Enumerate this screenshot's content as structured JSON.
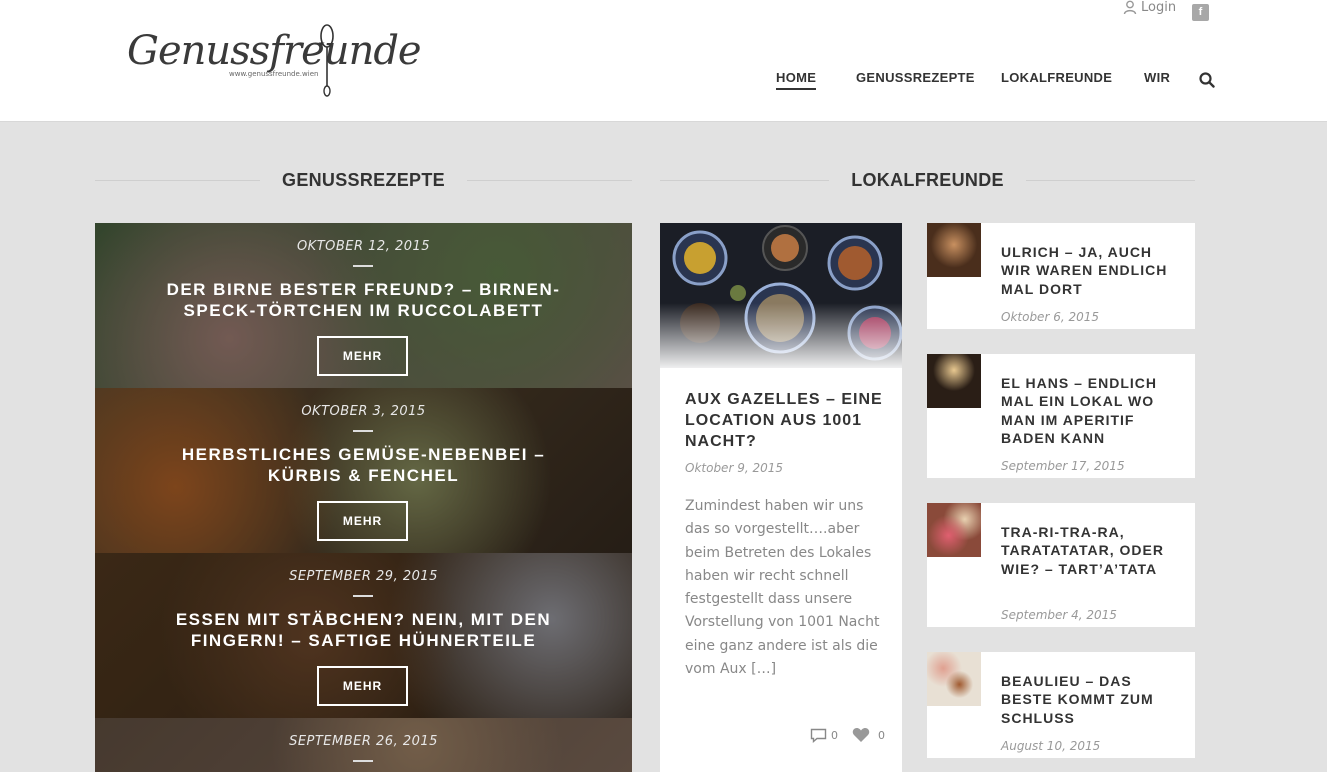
{
  "header": {
    "logo_text": "Genussfreunde",
    "logo_sub": "www.genussfreunde.wien",
    "login_label": "Login",
    "fb_label": "f",
    "nav": [
      {
        "label": "HOME",
        "active": true
      },
      {
        "label": "GENUSSREZEPTE"
      },
      {
        "label": "LOKALFREUNDE"
      },
      {
        "label": "WIR"
      }
    ]
  },
  "sections": {
    "left_title": "GENUSSREZEPTE",
    "right_title": "LOKALFREUNDE"
  },
  "recipes": [
    {
      "date": "OKTOBER 12, 2015",
      "title": "DER BIRNE BESTER FREUND? – BIRNEN-SPECK-TÖRTCHEN IM RUCCOLABETT",
      "button": "MEHR",
      "color_a": "#4f6a45",
      "color_b": "#8a7a6c"
    },
    {
      "date": "OKTOBER 3, 2015",
      "title": "HERBSTLICHES GEMÜSE-NEBENBEI – KÜRBIS & FENCHEL",
      "button": "MEHR",
      "color_a": "#6b5436",
      "color_b": "#a06a3a"
    },
    {
      "date": "SEPTEMBER 29, 2015",
      "title": "ESSEN MIT STÄBCHEN? NEIN, MIT DEN FINGERN! – SAFTIGE HÜHNERTEILE",
      "button": "MEHR",
      "color_a": "#5a3e22",
      "color_b": "#8a6b55"
    },
    {
      "date": "SEPTEMBER 26, 2015",
      "title": "",
      "button": "",
      "color_a": "#6c5848",
      "color_b": "#9a8270"
    }
  ],
  "featured": {
    "title": "AUX GAZELLES – EINE LOCATION AUS 1001 NACHT?",
    "date": "Oktober 9, 2015",
    "excerpt": "Zumindest haben wir uns das so vorgestellt….aber beim Betreten des Lokales haben wir recht schnell festgestellt dass unsere Vorstellung von 1001 Nacht eine ganz andere ist als die vom Aux […]",
    "comments": "0",
    "likes": "0"
  },
  "side_posts": [
    {
      "title": "ULRICH – JA, AUCH WIR WAREN ENDLICH MAL DORT",
      "date": "Oktober 6, 2015",
      "thumb_color": "#5a3a22"
    },
    {
      "title": "EL HANS – ENDLICH MAL EIN LOKAL WO MAN IM APERITIF BADEN KANN",
      "date": "September 17, 2015",
      "thumb_color": "#3a2a1e"
    },
    {
      "title": "TRA-RI-TRA-RA, TARATATATAR, ODER WIE? – TART’A’TATA",
      "date": "September 4, 2015",
      "thumb_color": "#a05a4a"
    },
    {
      "title": "BEAULIEU – DAS BESTE KOMMT ZUM SCHLUSS",
      "date": "August 10, 2015",
      "thumb_color": "#d8cfc2"
    }
  ]
}
